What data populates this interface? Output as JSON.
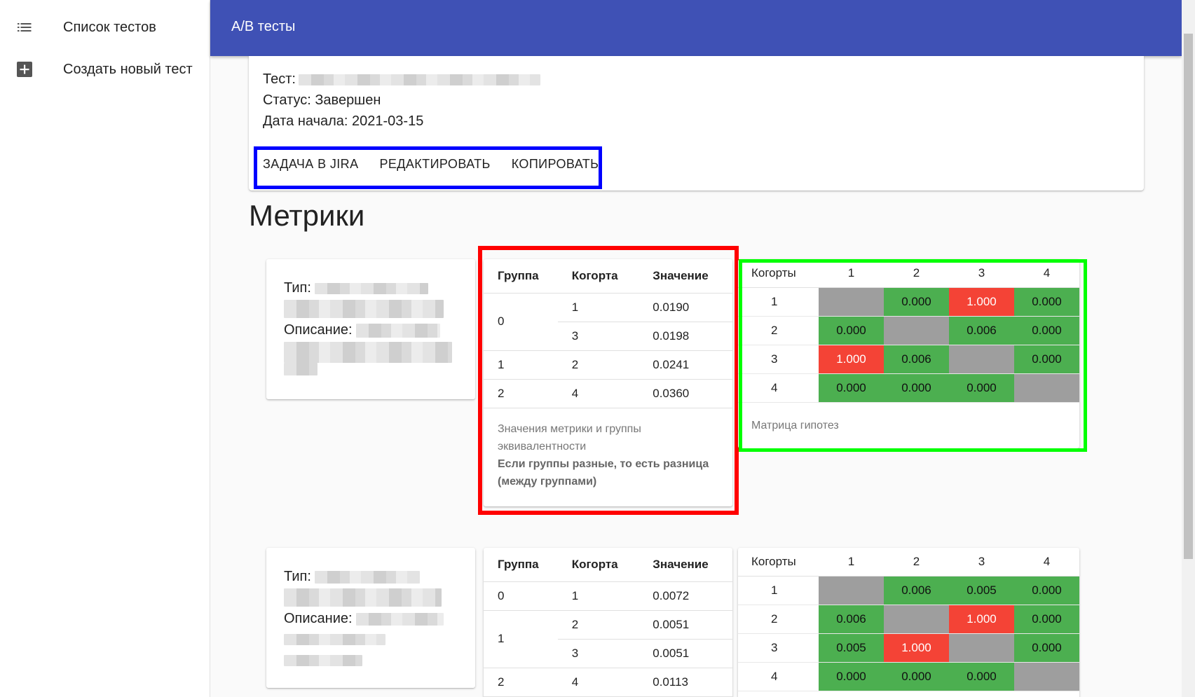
{
  "sidebar": {
    "items": [
      {
        "label": "Список тестов",
        "icon": "list-icon"
      },
      {
        "label": "Создать новый тест",
        "icon": "add-box-icon"
      }
    ]
  },
  "appbar": {
    "title": "A/B тесты"
  },
  "test_info": {
    "test_label": "Тест:",
    "status": "Статус: Завершен",
    "start_date": "Дата начала: 2021-03-15",
    "actions": [
      "ЗАДАЧА В JIRA",
      "РЕДАКТИРОВАТЬ",
      "КОПИРОВАТЬ"
    ]
  },
  "metrics_title": "Метрики",
  "metrics": [
    {
      "type_label": "Тип:",
      "description_label": "Описание:",
      "values_table": {
        "headers": [
          "Группа",
          "Когорта",
          "Значение"
        ],
        "groups": [
          {
            "group": "0",
            "rows": [
              {
                "cohort": "1",
                "value": "0.0190"
              },
              {
                "cohort": "3",
                "value": "0.0198"
              }
            ]
          },
          {
            "group": "1",
            "rows": [
              {
                "cohort": "2",
                "value": "0.0241"
              }
            ]
          },
          {
            "group": "2",
            "rows": [
              {
                "cohort": "4",
                "value": "0.0360"
              }
            ]
          }
        ],
        "caption": "Значения метрики и группы эквивалентности",
        "caption_bold": "Если группы разные, то есть разница (между группами)"
      },
      "matrix": {
        "corner": "Когорты",
        "cols": [
          "1",
          "2",
          "3",
          "4"
        ],
        "rows": [
          {
            "label": "1",
            "cells": [
              {
                "v": "",
                "c": "grey"
              },
              {
                "v": "0.000",
                "c": "green"
              },
              {
                "v": "1.000",
                "c": "red"
              },
              {
                "v": "0.000",
                "c": "green"
              }
            ]
          },
          {
            "label": "2",
            "cells": [
              {
                "v": "0.000",
                "c": "green"
              },
              {
                "v": "",
                "c": "grey"
              },
              {
                "v": "0.006",
                "c": "green"
              },
              {
                "v": "0.000",
                "c": "green"
              }
            ]
          },
          {
            "label": "3",
            "cells": [
              {
                "v": "1.000",
                "c": "red"
              },
              {
                "v": "0.006",
                "c": "green"
              },
              {
                "v": "",
                "c": "grey"
              },
              {
                "v": "0.000",
                "c": "green"
              }
            ]
          },
          {
            "label": "4",
            "cells": [
              {
                "v": "0.000",
                "c": "green"
              },
              {
                "v": "0.000",
                "c": "green"
              },
              {
                "v": "0.000",
                "c": "green"
              },
              {
                "v": "",
                "c": "grey"
              }
            ]
          }
        ],
        "caption": "Матрица гипотез"
      }
    },
    {
      "type_label": "Тип:",
      "description_label": "Описание:",
      "values_table": {
        "headers": [
          "Группа",
          "Когорта",
          "Значение"
        ],
        "groups": [
          {
            "group": "0",
            "rows": [
              {
                "cohort": "1",
                "value": "0.0072"
              }
            ]
          },
          {
            "group": "1",
            "rows": [
              {
                "cohort": "2",
                "value": "0.0051"
              },
              {
                "cohort": "3",
                "value": "0.0051"
              }
            ]
          },
          {
            "group": "2",
            "rows": [
              {
                "cohort": "4",
                "value": "0.0113"
              }
            ]
          }
        ]
      },
      "matrix": {
        "corner": "Когорты",
        "cols": [
          "1",
          "2",
          "3",
          "4"
        ],
        "rows": [
          {
            "label": "1",
            "cells": [
              {
                "v": "",
                "c": "grey"
              },
              {
                "v": "0.006",
                "c": "green"
              },
              {
                "v": "0.005",
                "c": "green"
              },
              {
                "v": "0.000",
                "c": "green"
              }
            ]
          },
          {
            "label": "2",
            "cells": [
              {
                "v": "0.006",
                "c": "green"
              },
              {
                "v": "",
                "c": "grey"
              },
              {
                "v": "1.000",
                "c": "red"
              },
              {
                "v": "0.000",
                "c": "green"
              }
            ]
          },
          {
            "label": "3",
            "cells": [
              {
                "v": "0.005",
                "c": "green"
              },
              {
                "v": "1.000",
                "c": "red"
              },
              {
                "v": "",
                "c": "grey"
              },
              {
                "v": "0.000",
                "c": "green"
              }
            ]
          },
          {
            "label": "4",
            "cells": [
              {
                "v": "0.000",
                "c": "green"
              },
              {
                "v": "0.000",
                "c": "green"
              },
              {
                "v": "0.000",
                "c": "green"
              },
              {
                "v": "",
                "c": "grey"
              }
            ]
          }
        ]
      }
    }
  ],
  "colors": {
    "appbar": "#3f51b5",
    "cell_green": "#4caf50",
    "cell_red": "#f44336",
    "cell_grey": "#9e9e9e",
    "highlight_blue": "#0000ff",
    "highlight_red": "#ff0000",
    "highlight_green": "#00ff00"
  }
}
